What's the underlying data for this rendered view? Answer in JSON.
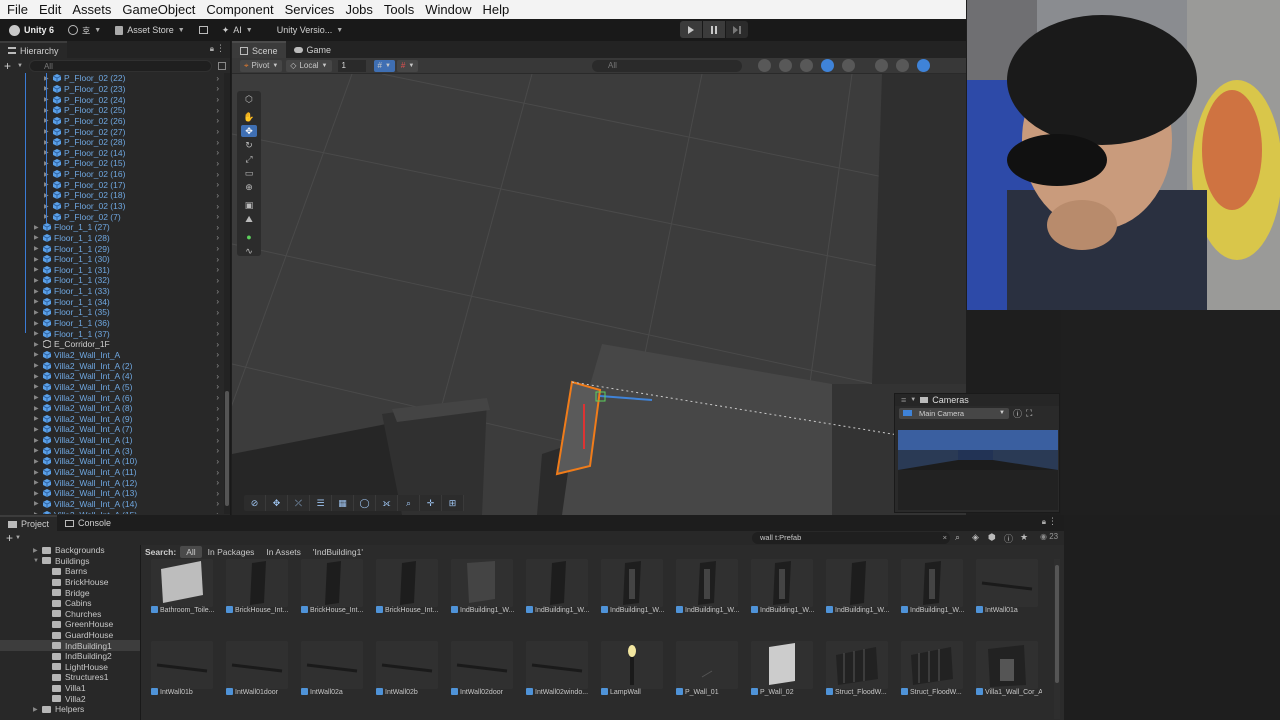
{
  "menu": [
    "File",
    "Edit",
    "Assets",
    "GameObject",
    "Component",
    "Services",
    "Jobs",
    "Tools",
    "Window",
    "Help"
  ],
  "toolbar": {
    "unity_label": "Unity 6",
    "account_label": "호",
    "asset_store_label": "Asset Store",
    "ai_label": "AI",
    "version_label": "Unity Versio..."
  },
  "hierarchy": {
    "tab_label": "Hierarchy",
    "search_placeholder": "All",
    "items": [
      {
        "label": "P_Floor_02 (22)",
        "indent": 2
      },
      {
        "label": "P_Floor_02 (23)",
        "indent": 2
      },
      {
        "label": "P_Floor_02 (24)",
        "indent": 2
      },
      {
        "label": "P_Floor_02 (25)",
        "indent": 2
      },
      {
        "label": "P_Floor_02 (26)",
        "indent": 2
      },
      {
        "label": "P_Floor_02 (27)",
        "indent": 2
      },
      {
        "label": "P_Floor_02 (28)",
        "indent": 2
      },
      {
        "label": "P_Floor_02 (14)",
        "indent": 2
      },
      {
        "label": "P_Floor_02 (15)",
        "indent": 2
      },
      {
        "label": "P_Floor_02 (16)",
        "indent": 2
      },
      {
        "label": "P_Floor_02 (17)",
        "indent": 2
      },
      {
        "label": "P_Floor_02 (18)",
        "indent": 2
      },
      {
        "label": "P_Floor_02 (13)",
        "indent": 2
      },
      {
        "label": "P_Floor_02 (7)",
        "indent": 2
      },
      {
        "label": "Floor_1_1 (27)",
        "indent": 1
      },
      {
        "label": "Floor_1_1 (28)",
        "indent": 1
      },
      {
        "label": "Floor_1_1 (29)",
        "indent": 1
      },
      {
        "label": "Floor_1_1 (30)",
        "indent": 1
      },
      {
        "label": "Floor_1_1 (31)",
        "indent": 1
      },
      {
        "label": "Floor_1_1 (32)",
        "indent": 1
      },
      {
        "label": "Floor_1_1 (33)",
        "indent": 1
      },
      {
        "label": "Floor_1_1 (34)",
        "indent": 1
      },
      {
        "label": "Floor_1_1 (35)",
        "indent": 1
      },
      {
        "label": "Floor_1_1 (36)",
        "indent": 1
      },
      {
        "label": "Floor_1_1 (37)",
        "indent": 1
      },
      {
        "label": "E_Corridor_1F",
        "indent": 1,
        "kind": "empty"
      },
      {
        "label": "Villa2_Wall_Int_A",
        "indent": 1
      },
      {
        "label": "Villa2_Wall_Int_A (2)",
        "indent": 1
      },
      {
        "label": "Villa2_Wall_Int_A (4)",
        "indent": 1
      },
      {
        "label": "Villa2_Wall_Int_A (5)",
        "indent": 1
      },
      {
        "label": "Villa2_Wall_Int_A (6)",
        "indent": 1
      },
      {
        "label": "Villa2_Wall_Int_A (8)",
        "indent": 1
      },
      {
        "label": "Villa2_Wall_Int_A (9)",
        "indent": 1
      },
      {
        "label": "Villa2_Wall_Int_A (7)",
        "indent": 1
      },
      {
        "label": "Villa2_Wall_Int_A (1)",
        "indent": 1
      },
      {
        "label": "Villa2_Wall_Int_A (3)",
        "indent": 1
      },
      {
        "label": "Villa2_Wall_Int_A (10)",
        "indent": 1
      },
      {
        "label": "Villa2_Wall_Int_A (11)",
        "indent": 1
      },
      {
        "label": "Villa2_Wall_Int_A (12)",
        "indent": 1
      },
      {
        "label": "Villa2_Wall_Int_A (13)",
        "indent": 1
      },
      {
        "label": "Villa2_Wall_Int_A (14)",
        "indent": 1
      },
      {
        "label": "Villa2_Wall_Int_A (15)",
        "indent": 1
      }
    ]
  },
  "scene": {
    "tabs": [
      "Scene",
      "Game"
    ],
    "pivot_label": "Pivot",
    "local_label": "Local",
    "grid_value": "1",
    "search_placeholder": "All"
  },
  "cameras": {
    "title": "Cameras",
    "selected": "Main Camera"
  },
  "project": {
    "tabs": [
      "Project",
      "Console"
    ],
    "search_value": "wall t:Prefab",
    "count_label": "23",
    "filter": {
      "label": "Search:",
      "chips": [
        "All",
        "In Packages",
        "In Assets",
        "'IndBuilding1'"
      ],
      "active_index": 0
    },
    "folders": [
      {
        "label": "Backgrounds",
        "indent": 2
      },
      {
        "label": "Buildings",
        "indent": 2,
        "open": true
      },
      {
        "label": "Barns",
        "indent": 3
      },
      {
        "label": "BrickHouse",
        "indent": 3
      },
      {
        "label": "Bridge",
        "indent": 3
      },
      {
        "label": "Cabins",
        "indent": 3
      },
      {
        "label": "Churches",
        "indent": 3
      },
      {
        "label": "GreenHouse",
        "indent": 3
      },
      {
        "label": "GuardHouse",
        "indent": 3
      },
      {
        "label": "IndBuilding1",
        "indent": 3,
        "selected": true
      },
      {
        "label": "IndBuilding2",
        "indent": 3
      },
      {
        "label": "LightHouse",
        "indent": 3
      },
      {
        "label": "Structures1",
        "indent": 3
      },
      {
        "label": "Villa1",
        "indent": 3
      },
      {
        "label": "Villa2",
        "indent": 3
      },
      {
        "label": "Helpers",
        "indent": 2
      }
    ],
    "assets_row1": [
      "Bathroom_Toile...",
      "BrickHouse_Int...",
      "BrickHouse_Int...",
      "BrickHouse_Int...",
      "IndBuilding1_W...",
      "IndBuilding1_W...",
      "IndBuilding1_W...",
      "IndBuilding1_W...",
      "IndBuilding1_W...",
      "IndBuilding1_W...",
      "IndBuilding1_W...",
      "IntWall01a"
    ],
    "assets_row2": [
      "IntWall01b",
      "IntWall01door",
      "IntWall02a",
      "IntWall02b",
      "IntWall02door",
      "IntWall02windo...",
      "LampWall",
      "P_Wall_01",
      "P_Wall_02",
      "Struct_FloodW...",
      "Struct_FloodW...",
      "Villa1_Wall_Cor_A"
    ]
  },
  "colors": {
    "accent_blue": "#3f83d8",
    "selection_orange": "#f07c1a",
    "hierarchy_text": "#6fa7e0"
  }
}
